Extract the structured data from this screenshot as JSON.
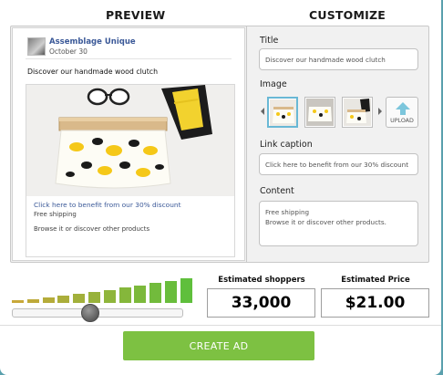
{
  "headers": {
    "preview": "PREVIEW",
    "customize": "CUSTOMIZE"
  },
  "preview": {
    "page_name": "Assemblage Unique",
    "post_date": "October 30",
    "post_text": "Discover our handmade wood clutch",
    "ad_caption": "Click here to benefit from our 30% discount",
    "ad_description_line1": "Free shipping",
    "ad_description_line2": "Browse it or discover other products"
  },
  "customize": {
    "title_label": "Title",
    "title_value": "Discover our handmade wood clutch",
    "image_label": "Image",
    "upload_label": "UPLOAD",
    "link_caption_label": "Link caption",
    "link_caption_value": "Click here to benefit from our 30% discount",
    "content_label": "Content",
    "content_value": "Free shipping\nBrowse it or discover other products."
  },
  "budget": {
    "slider_level": 0.45,
    "bar_levels": [
      0.1,
      0.14,
      0.2,
      0.27,
      0.33,
      0.4,
      0.47,
      0.55,
      0.63,
      0.72,
      0.81,
      0.9
    ],
    "colors": {
      "bar_low": "#c8a83a",
      "bar_high": "#5fbf3c"
    }
  },
  "stats": {
    "shoppers_label": "Estimated shoppers",
    "shoppers_value": "33,000",
    "price_label": "Estimated Price",
    "price_value": "$21.00"
  },
  "actions": {
    "create_ad_label": "CREATE AD"
  },
  "colors": {
    "accent_green": "#7dc142",
    "link_blue": "#3b5998",
    "selected_thumb_border": "#69b8d5"
  }
}
